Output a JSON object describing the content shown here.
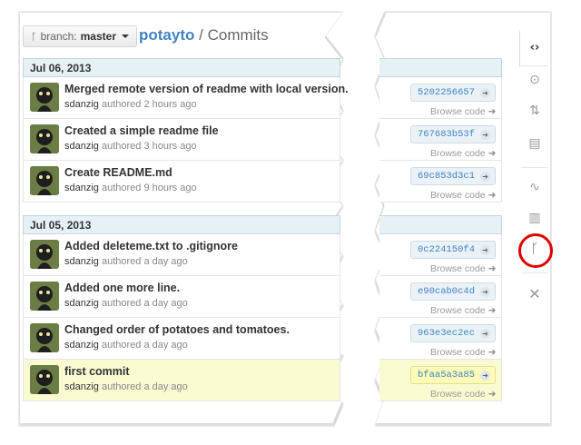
{
  "header": {
    "branch_label": "branch:",
    "branch_value": "master",
    "repo": "potayto",
    "separator": "/",
    "page": "Commits"
  },
  "groups": [
    {
      "date": "Jul 06, 2013",
      "commits": [
        {
          "message": "Merged remote version of readme with local version.",
          "author": "sdanzig",
          "time": "authored 2 hours ago",
          "sha": "5202256657",
          "browse": "Browse code",
          "highlight": false
        },
        {
          "message": "Created a simple readme file",
          "author": "sdanzig",
          "time": "authored 3 hours ago",
          "sha": "767683b53f",
          "browse": "Browse code",
          "highlight": false
        },
        {
          "message": "Create README.md",
          "author": "sdanzig",
          "time": "authored 9 hours ago",
          "sha": "69c853d3c1",
          "browse": "Browse code",
          "highlight": false
        }
      ]
    },
    {
      "date": "Jul 05, 2013",
      "commits": [
        {
          "message": "Added deleteme.txt to .gitignore",
          "author": "sdanzig",
          "time": "authored a day ago",
          "sha": "0c224150f4",
          "browse": "Browse code",
          "highlight": false
        },
        {
          "message": "Added one more line.",
          "author": "sdanzig",
          "time": "authored a day ago",
          "sha": "e90cab0c4d",
          "browse": "Browse code",
          "highlight": false
        },
        {
          "message": "Changed order of potatoes and tomatoes.",
          "author": "sdanzig",
          "time": "authored a day ago",
          "sha": "963e3ec2ec",
          "browse": "Browse code",
          "highlight": false
        },
        {
          "message": "first commit",
          "author": "sdanzig",
          "time": "authored a day ago",
          "sha": "bfaa5a3a85",
          "browse": "Browse code",
          "highlight": true
        }
      ]
    }
  ],
  "sidebar": {
    "icons": [
      "code-icon",
      "issues-icon",
      "pull-request-icon",
      "wiki-icon",
      "pulse-icon",
      "graphs-icon",
      "network-icon",
      "settings-icon"
    ],
    "highlight_color": "#e00000"
  },
  "colors": {
    "link": "#4183c4",
    "date_bar": "#e6f1f6",
    "highlight_row": "#fafad2"
  }
}
